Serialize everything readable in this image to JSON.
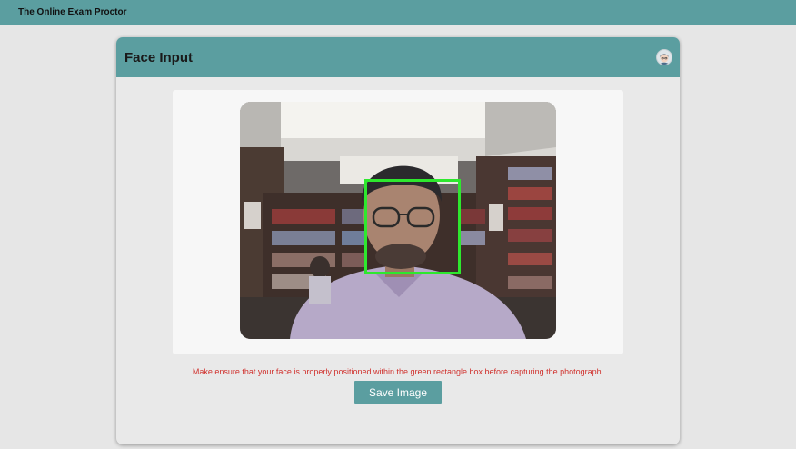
{
  "app": {
    "title": "The Online Exam Proctor"
  },
  "card": {
    "title": "Face Input",
    "avatar_icon": "user-avatar-icon"
  },
  "camera": {
    "face_box_color": "#2ee82e"
  },
  "instruction": "Make ensure that your face is properly positioned within the green rectangle box before capturing the photograph.",
  "actions": {
    "save_label": "Save Image"
  },
  "colors": {
    "header": "#5b9ea0",
    "background": "#e6e6e6",
    "instruction_text": "#d0312d"
  }
}
